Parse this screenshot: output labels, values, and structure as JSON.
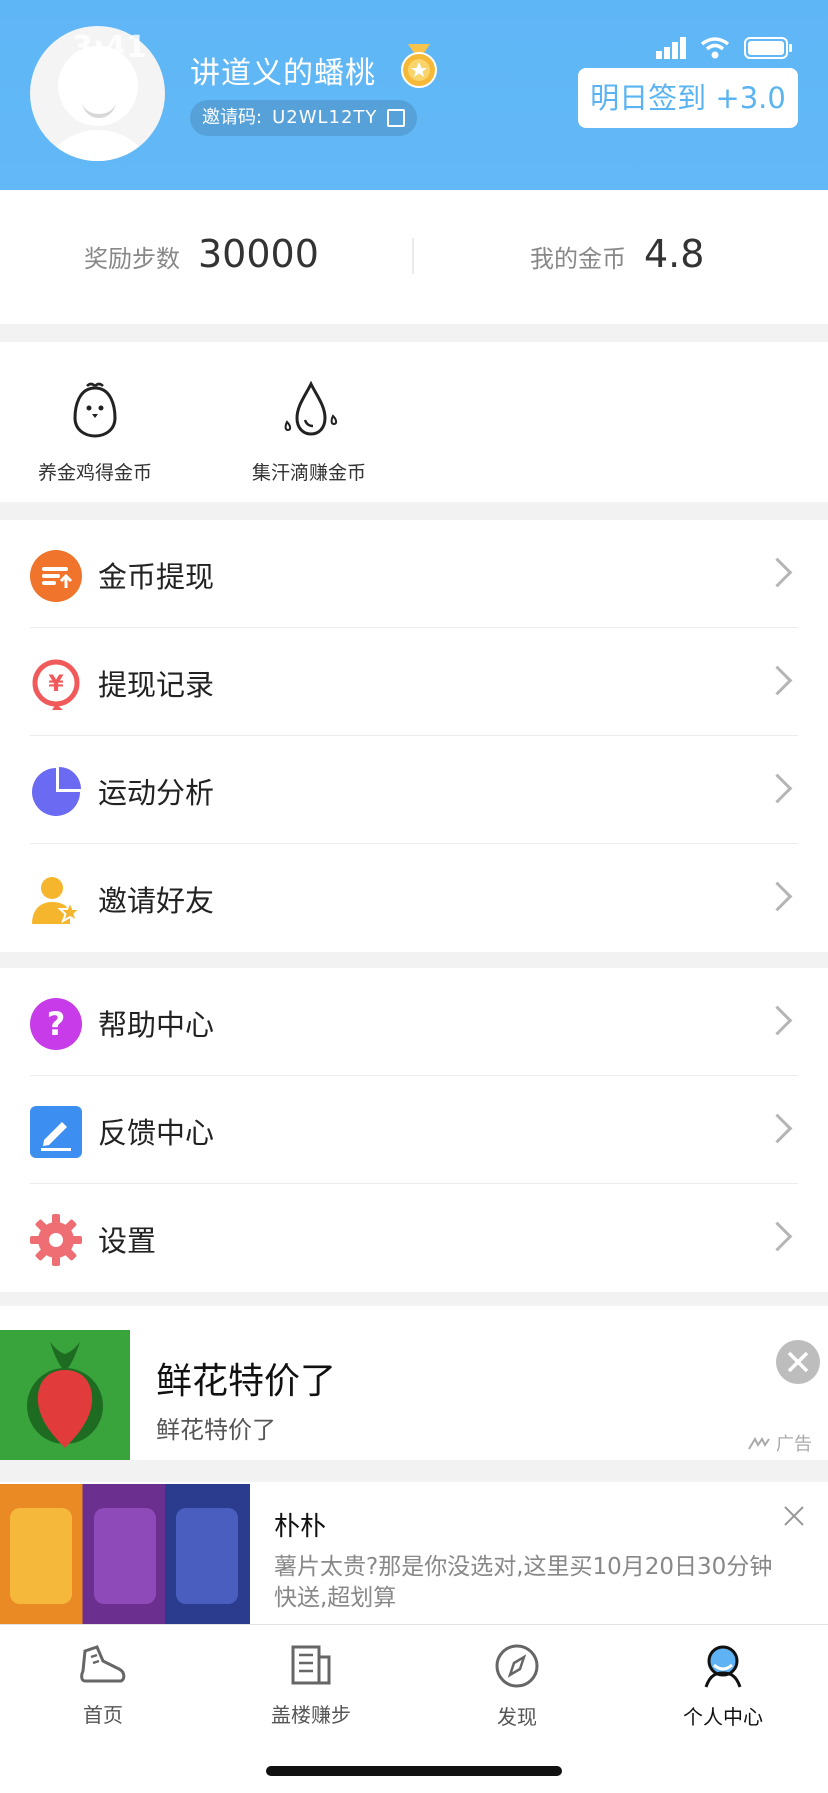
{
  "status_bar": {
    "time": "3:41"
  },
  "profile": {
    "username": "讲道义的蟠桃",
    "invite_label": "邀请码:",
    "invite_code": "U2WL12TY",
    "checkin_label": "明日签到 +3.0"
  },
  "stats": {
    "reward_steps_label": "奖励步数",
    "reward_steps_value": "30000",
    "coins_label": "我的金币",
    "coins_value": "4.8"
  },
  "quick_actions": [
    {
      "label": "养金鸡得金币",
      "icon": "chick-icon"
    },
    {
      "label": "集汗滴赚金币",
      "icon": "sweat-drop-icon"
    }
  ],
  "menu_group1": [
    {
      "label": "金币提现",
      "icon": "coin-withdraw-icon",
      "color": "#f0742b"
    },
    {
      "label": "提现记录",
      "icon": "withdraw-record-icon",
      "color": "#f15a5a"
    },
    {
      "label": "运动分析",
      "icon": "pie-chart-icon",
      "color": "#6b6af2"
    },
    {
      "label": "邀请好友",
      "icon": "invite-friend-icon",
      "color": "#f5b62e"
    }
  ],
  "menu_group2": [
    {
      "label": "帮助中心",
      "icon": "help-icon",
      "color": "#c73ce8"
    },
    {
      "label": "反馈中心",
      "icon": "feedback-icon",
      "color": "#3c8ef0"
    },
    {
      "label": "设置",
      "icon": "settings-gear-icon",
      "color": "#ee6e73"
    }
  ],
  "ad1": {
    "title": "鲜花特价了",
    "subtitle": "鲜花特价了",
    "badge": "广告"
  },
  "ad2": {
    "title": "朴朴",
    "description": "薯片太贵?那是你没选对,这里买10月20日30分钟快送,超划算"
  },
  "tabbar": [
    {
      "label": "首页",
      "icon": "running-shoe-icon",
      "active": false
    },
    {
      "label": "盖楼赚步",
      "icon": "building-icon",
      "active": false
    },
    {
      "label": "发现",
      "icon": "compass-icon",
      "active": false
    },
    {
      "label": "个人中心",
      "icon": "person-icon",
      "active": true
    }
  ]
}
